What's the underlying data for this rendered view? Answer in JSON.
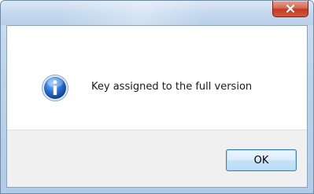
{
  "dialog": {
    "title": "",
    "message": "Key assigned to the full version",
    "ok_label": "OK",
    "icon": "info-icon"
  },
  "titlebar": {
    "close_icon": "close-icon"
  },
  "colors": {
    "close_button": "#c43a22",
    "info_icon_blue": "#1f62c2"
  }
}
